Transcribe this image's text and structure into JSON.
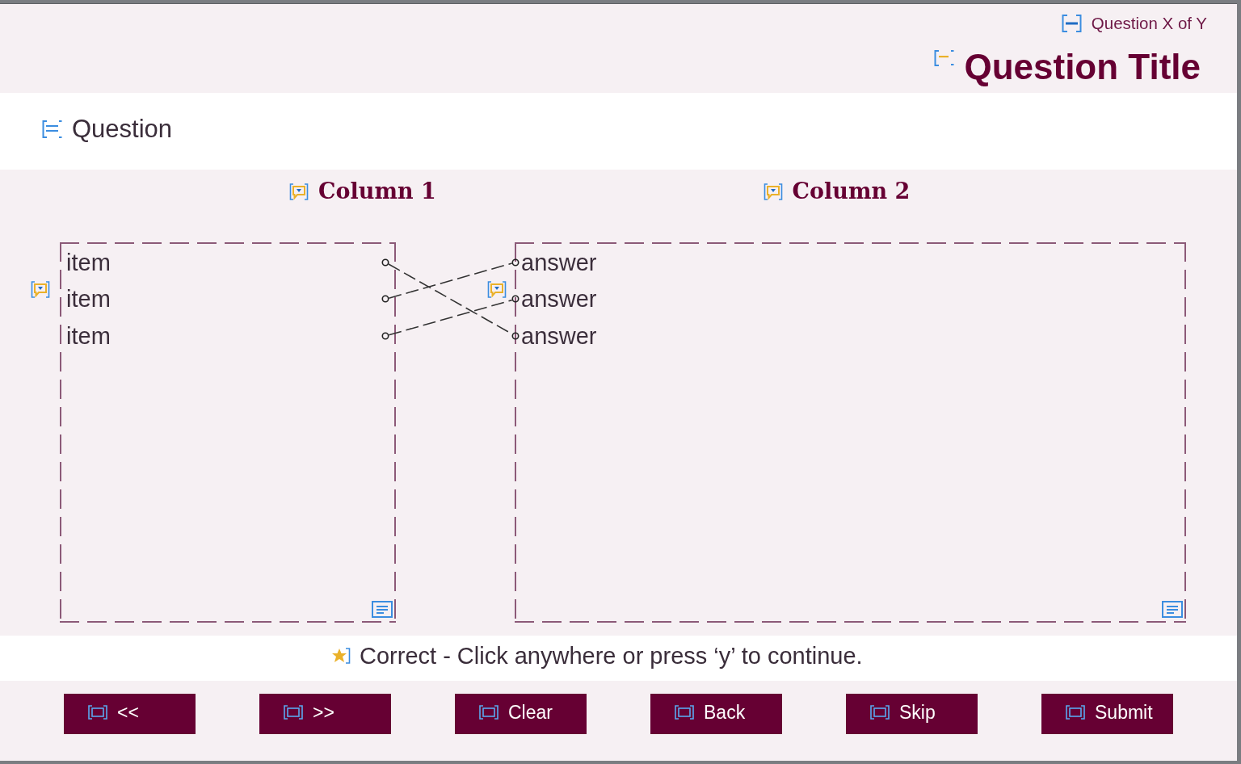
{
  "header": {
    "counter": "Question X of Y",
    "title": "Question Title"
  },
  "question": "Question",
  "columns": [
    {
      "kind": "source",
      "heading": "Column 1",
      "entries": [
        {
          "text": "item",
          "links": [
            false,
            false,
            true
          ]
        },
        {
          "text": "item",
          "links": [
            true,
            false,
            false
          ]
        },
        {
          "text": "item",
          "links": [
            false,
            true,
            false
          ]
        }
      ]
    },
    {
      "kind": "target",
      "heading": "Column 2",
      "entries": [
        {
          "text": "answer"
        },
        {
          "text": "answer"
        },
        {
          "text": "answer"
        }
      ]
    }
  ],
  "feedback": "Correct - Click anywhere or press ‘y’ to continue.",
  "buttons": [
    "<<",
    ">>",
    "Clear",
    "Back",
    "Skip",
    "Submit"
  ]
}
